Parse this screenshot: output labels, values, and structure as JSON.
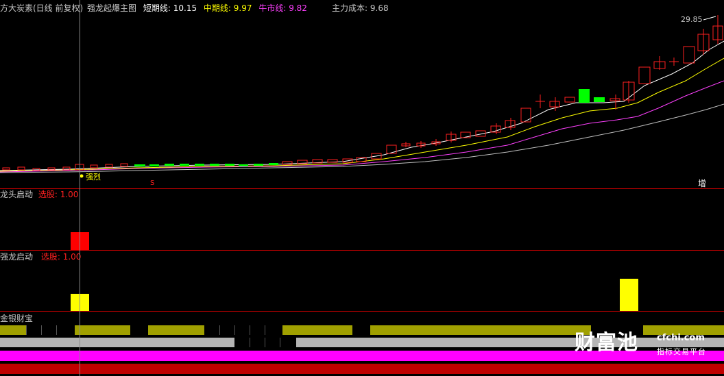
{
  "main_panel": {
    "stock_name": "方大炭素(日线 前复权)",
    "indicator_name": "强龙起爆主图",
    "short_label": "短期线:",
    "short_value": "10.15",
    "mid_label": "中期线:",
    "mid_value": "9.97",
    "bull_label": "牛市线:",
    "bull_value": "9.82",
    "cost_label": "主力成本:",
    "cost_value": "9.68",
    "high_price_label": "29.85",
    "signal_strong": "强烈",
    "signal_s": "S",
    "signal_add": "增",
    "colors": {
      "short": "#ffffff",
      "mid": "#ffff00",
      "bull": "#ff40ff",
      "cost": "#c0c0c0",
      "up": "#ff2020",
      "down": "#00ff00"
    }
  },
  "panel_dragon_head": {
    "title": "龙头启动",
    "select_label": "选股:",
    "select_value": "1.00",
    "bar_color": "#ff0000"
  },
  "panel_strong_dragon": {
    "title": "强龙启动",
    "select_label": "选股:",
    "select_value": "1.00",
    "bar_color": "#ffff00"
  },
  "panel_gold_silver": {
    "title": "金银财宝",
    "band_colors": [
      "#a0a000",
      "#b4b4b4",
      "#ff00ff",
      "#c00000"
    ]
  },
  "watermark": {
    "brand": "财富池",
    "domain": "cfchi.com",
    "slogan": "指标交易平台"
  }
}
